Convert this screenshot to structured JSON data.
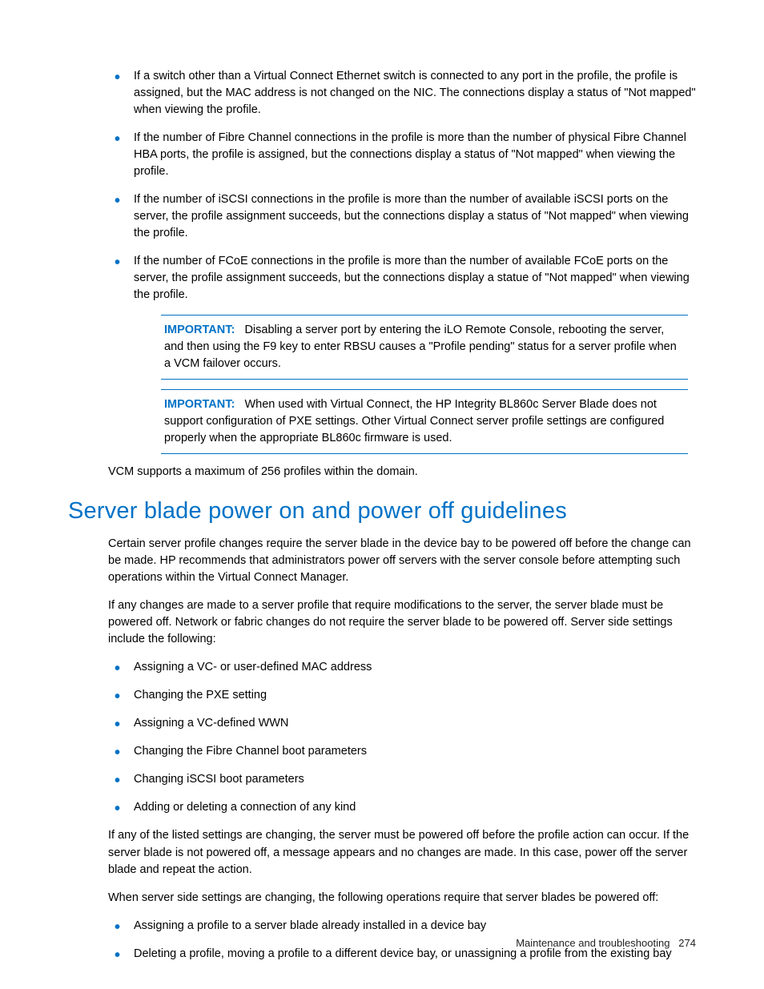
{
  "section1": {
    "bullets": [
      "If a switch other than a Virtual Connect Ethernet switch is connected to any port in the profile, the profile is assigned, but the MAC address is not changed on the NIC. The connections display a status of \"Not mapped\" when viewing the profile.",
      "If the number of Fibre Channel connections in the profile is more than the number of physical Fibre Channel HBA ports, the profile is assigned, but the connections display a status of \"Not mapped\" when viewing the profile.",
      "If the number of iSCSI connections in the profile is more than the number of available iSCSI ports on the server, the profile assignment succeeds, but the connections display a status of \"Not mapped\" when viewing the profile.",
      "If the number of FCoE connections in the profile is more than the number of available FCoE ports on the server, the profile assignment succeeds, but the connections display a statue of \"Not mapped\" when viewing the profile."
    ],
    "important1": {
      "label": "IMPORTANT:",
      "text": "Disabling a server port by entering the iLO Remote Console, rebooting the server, and then using the F9 key to enter RBSU causes a \"Profile pending\" status for a server profile when a VCM failover occurs."
    },
    "important2": {
      "label": "IMPORTANT:",
      "text": "When used with Virtual Connect, the HP Integrity BL860c Server Blade does not support configuration of PXE settings. Other Virtual Connect server profile settings are configured properly when the appropriate BL860c firmware is used."
    },
    "closing": "VCM supports a maximum of 256 profiles within the domain."
  },
  "section2": {
    "title": "Server blade power on and power off guidelines",
    "para1": "Certain server profile changes require the server blade in the device bay to be powered off before the change can be made. HP recommends that administrators power off servers with the server console before attempting such operations within the Virtual Connect Manager.",
    "para2": "If any changes are made to a server profile that require modifications to the server, the server blade must be powered off. Network or fabric changes do not require the server blade to be powered off. Server side settings include the following:",
    "bullets1": [
      "Assigning a VC- or user-defined MAC address",
      "Changing the PXE setting",
      "Assigning a VC-defined WWN",
      "Changing the Fibre Channel boot parameters",
      "Changing iSCSI boot parameters",
      "Adding or deleting a connection of any kind"
    ],
    "para3": "If any of the listed settings are changing, the server must be powered off before the profile action can occur. If the server blade is not powered off, a message appears and no changes are made. In this case, power off the server blade and repeat the action.",
    "para4": "When server side settings are changing, the following operations require that server blades be powered off:",
    "bullets2": [
      "Assigning a profile to a server blade already installed in a device bay",
      "Deleting a profile, moving a profile to a different device bay, or unassigning a profile from the existing bay"
    ]
  },
  "footer": {
    "section": "Maintenance and troubleshooting",
    "page": "274"
  }
}
